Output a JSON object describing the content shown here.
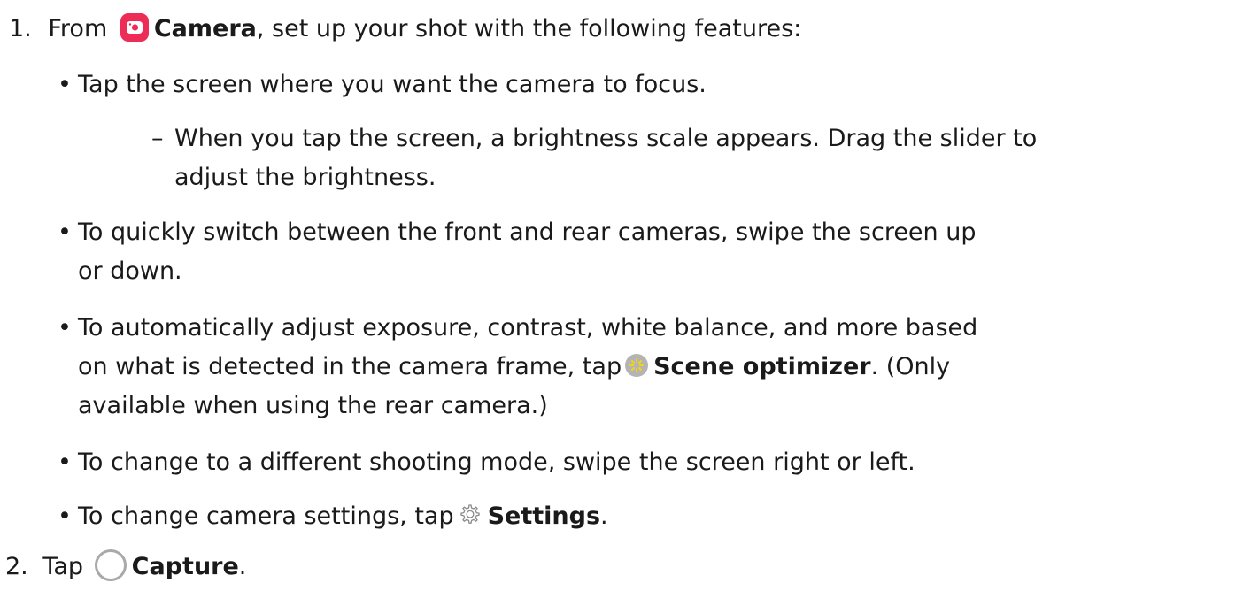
{
  "steps": [
    {
      "number": "1.",
      "pre": "From",
      "app_name": "Camera",
      "post": ", set up your shot with the following features:",
      "icon": "camera-app-icon"
    },
    {
      "number": "2.",
      "pre": "Tap",
      "action": "Capture",
      "post": ".",
      "icon": "capture-button-icon"
    }
  ],
  "bullets": [
    {
      "text": "Tap the screen where you want the camera to focus.",
      "sub": {
        "line1": "When you tap the screen, a brightness scale appears. Drag the slider to",
        "line2": "adjust the brightness."
      }
    },
    {
      "line1": "To quickly switch between the front and rear cameras, swipe the screen up",
      "line2": "or down."
    },
    {
      "line1": "To automatically adjust exposure, contrast, white balance, and more based",
      "line2_pre": "on what is detected in the camera frame, tap",
      "line2_bold": "Scene optimizer",
      "line2_post": ". (Only",
      "line3": "available when using the rear camera.)",
      "icon": "scene-optimizer-icon"
    },
    {
      "text": "To change to a different shooting mode, swipe the screen right or left."
    },
    {
      "pre": "To change camera settings, tap",
      "bold": "Settings",
      "post": ".",
      "icon": "settings-gear-icon"
    }
  ],
  "symbols": {
    "bullet": "•",
    "dash": "–"
  },
  "colors": {
    "text": "#1a1a1a",
    "camera_icon": "#ee2c58",
    "scene_icon": "#b4b4b4",
    "capture_ring": "#a9a9a9"
  }
}
